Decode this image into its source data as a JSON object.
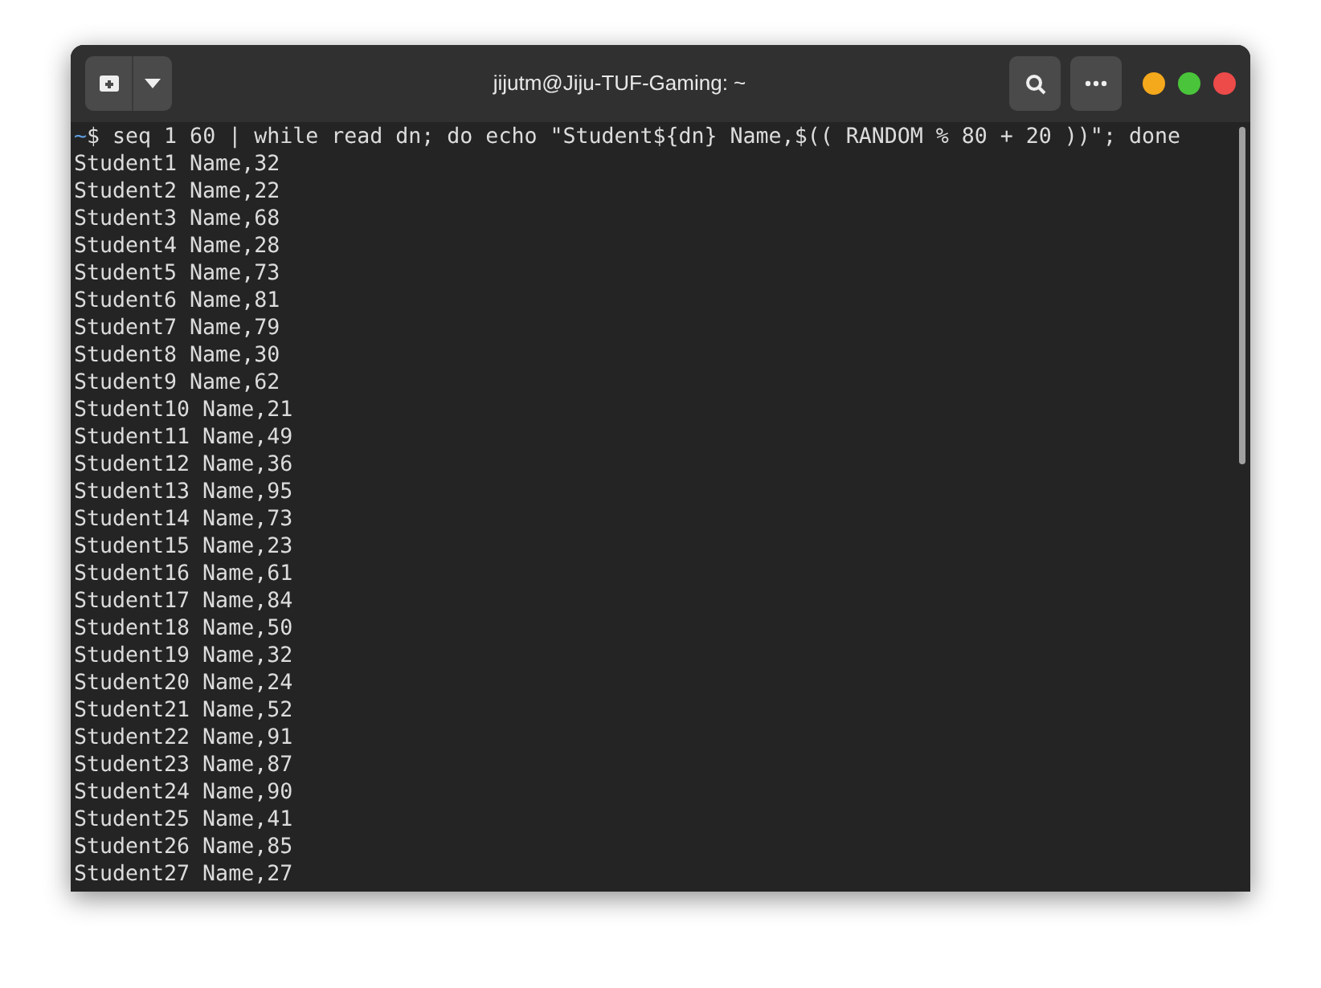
{
  "window": {
    "title": "jijutm@Jiju-TUF-Gaming: ~"
  },
  "terminal": {
    "prompt": "~",
    "command": "$ seq 1 60 | while read dn; do echo \"Student${dn} Name,$(( RANDOM % 80 + 20 ))\"; done",
    "output": [
      "Student1 Name,32",
      "Student2 Name,22",
      "Student3 Name,68",
      "Student4 Name,28",
      "Student5 Name,73",
      "Student6 Name,81",
      "Student7 Name,79",
      "Student8 Name,30",
      "Student9 Name,62",
      "Student10 Name,21",
      "Student11 Name,49",
      "Student12 Name,36",
      "Student13 Name,95",
      "Student14 Name,73",
      "Student15 Name,23",
      "Student16 Name,61",
      "Student17 Name,84",
      "Student18 Name,50",
      "Student19 Name,32",
      "Student20 Name,24",
      "Student21 Name,52",
      "Student22 Name,91",
      "Student23 Name,87",
      "Student24 Name,90",
      "Student25 Name,41",
      "Student26 Name,85",
      "Student27 Name,27"
    ]
  }
}
